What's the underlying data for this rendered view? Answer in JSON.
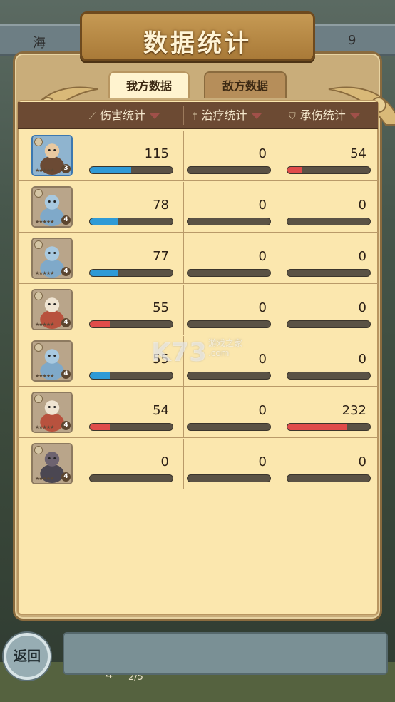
{
  "title": "数据统计",
  "tabs": [
    {
      "label": "我方数据",
      "active": true
    },
    {
      "label": "敌方数据",
      "active": false
    }
  ],
  "columns": [
    {
      "label": "伤害统计",
      "icon": "sword-icon"
    },
    {
      "label": "治疗统计",
      "icon": "cross-icon"
    },
    {
      "label": "承伤统计",
      "icon": "shield-icon"
    }
  ],
  "background": {
    "top_left_label": "海",
    "top_right_number": "9",
    "bottom_num": "4",
    "bottom_fraction": "2/5"
  },
  "bar_colors": {
    "blue": "#2f9ad6",
    "red": "#e04c4a",
    "track": "#5a5245"
  },
  "rows": [
    {
      "hero": "hero-monk",
      "level": "3",
      "damage": "115",
      "heal": "0",
      "taken": "54",
      "damage_fill": 0.5,
      "damage_color": "blue",
      "heal_fill": 0,
      "taken_fill": 0.17,
      "taken_color": "red"
    },
    {
      "hero": "hero-frog-mage",
      "level": "4",
      "damage": "78",
      "heal": "0",
      "taken": "0",
      "damage_fill": 0.34,
      "damage_color": "blue",
      "heal_fill": 0,
      "taken_fill": 0
    },
    {
      "hero": "hero-frog-mage",
      "level": "4",
      "damage": "77",
      "heal": "0",
      "taken": "0",
      "damage_fill": 0.34,
      "damage_color": "blue",
      "heal_fill": 0,
      "taken_fill": 0
    },
    {
      "hero": "hero-cat-warrior",
      "level": "4",
      "damage": "55",
      "heal": "0",
      "taken": "0",
      "damage_fill": 0.24,
      "damage_color": "red",
      "heal_fill": 0,
      "taken_fill": 0
    },
    {
      "hero": "hero-frog-mage",
      "level": "4",
      "damage": "55",
      "heal": "0",
      "taken": "0",
      "damage_fill": 0.24,
      "damage_color": "blue",
      "heal_fill": 0,
      "taken_fill": 0
    },
    {
      "hero": "hero-cat-warrior",
      "level": "4",
      "damage": "54",
      "heal": "0",
      "taken": "232",
      "damage_fill": 0.24,
      "damage_color": "red",
      "heal_fill": 0,
      "taken_fill": 0.72,
      "taken_color": "red"
    },
    {
      "hero": "hero-hooded-rogue",
      "level": "4",
      "damage": "0",
      "heal": "0",
      "taken": "0",
      "damage_fill": 0,
      "heal_fill": 0,
      "taken_fill": 0
    }
  ],
  "back_button": "返回",
  "watermark": {
    "main": "K73",
    "sub1": "游戏之家",
    "sub2": ".com"
  }
}
